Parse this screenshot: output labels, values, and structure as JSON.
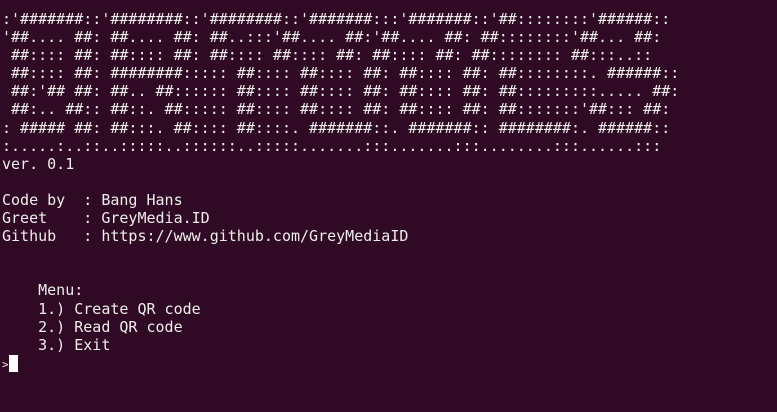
{
  "banner": [
    ":'#######::'########::'########::'#######:::'#######::'##::::::::'######::",
    "'##.... ##: ##.... ##: ##..:::'##.... ##:'##.... ##: ##::::::::'##... ##:",
    " ##:::: ##: ##:::: ##: ##:::: ##:::: ##: ##:::: ##: ##:::::::: ##:::..::",
    " ##:::: ##: ########::::: ##:::: ##:::: ##: ##:::: ##: ##::::::::. ######::",
    " ##:'## ##: ##.. ##:::::: ##:::: ##:::: ##: ##:::: ##: ##:::::::::..... ##:",
    " ##:.. ##:: ##::. ##::::: ##:::: ##:::: ##: ##:::: ##: ##:::::::'##::: ##:",
    ": ##### ##: ##:::. ##:::: ##::::. #######::. #######:: ########:. ######::",
    ":.....:..::..:::::..::::::..:::::.......:::.......:::........:::......:::"
  ],
  "version": "ver. 0.1",
  "info": [
    "Code by  : Bang Hans",
    "Greet    : GreyMedia.ID",
    "Github   : https://www.github.com/GreyMediaID"
  ],
  "menu": {
    "title": "    Menu:",
    "items": [
      "    1.) Create QR code",
      "    2.) Read QR code",
      "    3.) Exit"
    ]
  },
  "prompt": ">"
}
